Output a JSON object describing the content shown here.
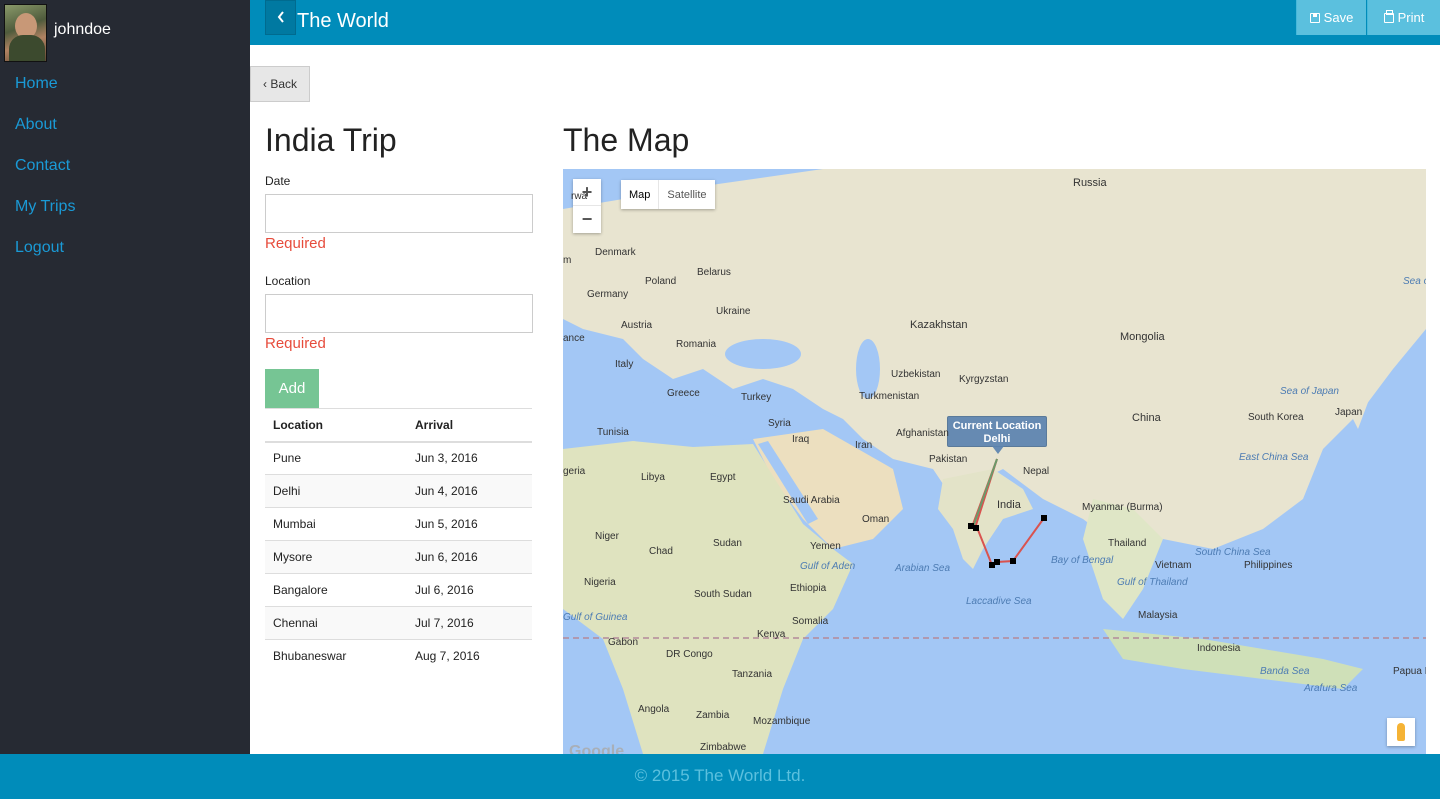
{
  "sidebar": {
    "username": "johndoe",
    "nav": [
      {
        "label": "Home"
      },
      {
        "label": "About"
      },
      {
        "label": "Contact"
      },
      {
        "label": "My Trips"
      },
      {
        "label": "Logout"
      }
    ]
  },
  "header": {
    "title": "The World",
    "save_label": "Save",
    "print_label": "Print"
  },
  "back_label": "‹ Back",
  "trip": {
    "title": "India Trip",
    "date_label": "Date",
    "date_value": "",
    "date_error": "Required",
    "location_label": "Location",
    "location_value": "",
    "location_error": "Required",
    "add_label": "Add",
    "columns": [
      "Location",
      "Arrival"
    ],
    "stops": [
      {
        "location": "Pune",
        "arrival": "Jun 3, 2016"
      },
      {
        "location": "Delhi",
        "arrival": "Jun 4, 2016"
      },
      {
        "location": "Mumbai",
        "arrival": "Jun 5, 2016"
      },
      {
        "location": "Mysore",
        "arrival": "Jun 6, 2016"
      },
      {
        "location": "Bangalore",
        "arrival": "Jul 6, 2016"
      },
      {
        "location": "Chennai",
        "arrival": "Jul 7, 2016"
      },
      {
        "location": "Bhubaneswar",
        "arrival": "Aug 7, 2016"
      }
    ]
  },
  "map": {
    "title": "The Map",
    "zoom_in": "+",
    "zoom_out": "−",
    "type_map": "Map",
    "type_satellite": "Satellite",
    "tooltip_line1": "Current Location",
    "tooltip_line2": "Delhi",
    "google_text": "Google",
    "labels": [
      "Russia",
      "Denmark",
      "Belarus",
      "Poland",
      "Germany",
      "Ukraine",
      "Austria",
      "Romania",
      "Italy",
      "Greece",
      "Turkey",
      "Kazakhstan",
      "Mongolia",
      "Uzbekistan",
      "Kyrgyzstan",
      "Turkmenistan",
      "Syria",
      "Iraq",
      "Iran",
      "Afghanistan",
      "Pakistan",
      "Nepal",
      "China",
      "South Korea",
      "Japan",
      "Sea of Japan",
      "Sea of Okhotsk",
      "East China Sea",
      "Tunisia",
      "Libya",
      "Egypt",
      "Saudi Arabia",
      "Oman",
      "Yemen",
      "Gulf of Aden",
      "Sudan",
      "Chad",
      "Niger",
      "Nigeria",
      "Ethiopia",
      "South Sudan",
      "Somalia",
      "Kenya",
      "DR Congo",
      "Gabon",
      "Tanzania",
      "Angola",
      "Zambia",
      "Mozambique",
      "Zimbabwe",
      "India",
      "Arabian Sea",
      "Laccadive Sea",
      "Bay of Bengal",
      "Myanmar (Burma)",
      "Thailand",
      "Gulf of Thailand",
      "Vietnam",
      "South China Sea",
      "Philippines",
      "Malaysia",
      "Indonesia",
      "Banda Sea",
      "Arafura Sea",
      "Papua New Guinea",
      "Gulf of Guinea",
      "geria",
      "ance",
      "rwa",
      "m"
    ],
    "colors": {
      "water": "#a3c7f5",
      "land": "#e8e4d0",
      "route_red": "#d9534f",
      "route_green": "#5cb85c"
    }
  },
  "footer": {
    "text": "© 2015 The World Ltd."
  },
  "colors": {
    "primary": "#008cba",
    "sidebar_bg": "#262a33",
    "link": "#1a9ad6",
    "info_button": "#5bc0de",
    "error": "#e74c3c",
    "success_button": "#76c594"
  }
}
